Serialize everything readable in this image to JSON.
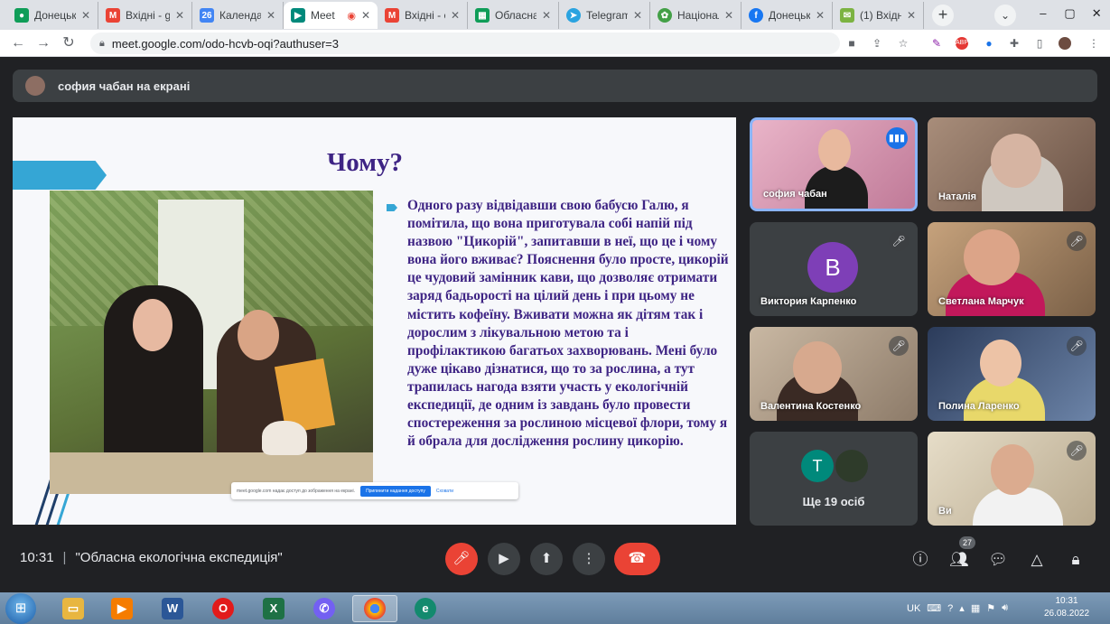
{
  "browser": {
    "tabs": [
      {
        "label": "Донецьк",
        "icon": "maps-pin-icon",
        "color": "#0f9d58"
      },
      {
        "label": "Вхідні - g",
        "icon": "gmail-icon",
        "color": "#ea4335"
      },
      {
        "label": "Календар",
        "icon": "calendar-icon",
        "color": "#4285f4"
      },
      {
        "label": "Meet",
        "icon": "meet-icon",
        "color": "#00897b",
        "active": true
      },
      {
        "label": "Вхідні - c",
        "icon": "gmail-icon",
        "color": "#ea4335"
      },
      {
        "label": "Обласна",
        "icon": "sheets-icon",
        "color": "#0f9d58"
      },
      {
        "label": "Telegram",
        "icon": "telegram-icon",
        "color": "#2aa3e0"
      },
      {
        "label": "Національ",
        "icon": "site-icon",
        "color": "#43a047"
      },
      {
        "label": "Донецьк",
        "icon": "facebook-icon",
        "color": "#1877f2"
      },
      {
        "label": "(1) Вхідн",
        "icon": "mail-icon",
        "color": "#7cb342"
      }
    ],
    "url": "meet.google.com/odo-hcvb-oqi?authuser=3"
  },
  "meet": {
    "presenter_label": "софия чабан на екрані",
    "slide": {
      "title": "Чому?",
      "body": "Одного разу відвідавши свою бабусю Галю, я помітила, що вона приготувала собі напій під назвою \"Цикорій\", запитавши в неї, що це і чому вона його вживає? Пояснення було просте, цикорій це чудовий замінник кави, що дозволяє отримати заряд бадьорості на цілий день і при цьому не містить кофеїну. Вживати можна як дітям так і дорослим з лікувальною метою та і профілактикою багатьох захворювань. Мені було дуже цікаво дізнатися, що то за рослина, а тут трапилась нагода взяти участь у екологічній експедиції, де одним із завдань було провести спостереження за рослиною місцевої флори, тому я й обрала для дослідження рослину цикорію.",
      "share_notice": "meet.google.com надає доступ до зображення на екрані.",
      "share_stop": "Припинити надання доступу",
      "share_hide": "Сховати"
    },
    "participants": [
      {
        "name": "софия чабан",
        "speaking": true
      },
      {
        "name": "Наталія",
        "speaking": false
      },
      {
        "name": "Виктория Карпенко",
        "avatar_letter": "B",
        "avatar_color": "#7e3fb7",
        "muted": true
      },
      {
        "name": "Светлана Марчук",
        "muted": true
      },
      {
        "name": "Валентина Костенко",
        "muted": true
      },
      {
        "name": "Полина Ларенко",
        "muted": true
      },
      {
        "name": "Ви",
        "muted": true
      }
    ],
    "others": {
      "label": "Ще 19 осіб",
      "avatar_letter": "T",
      "avatar_color": "#00897b"
    },
    "time": "10:31",
    "meeting_title": "\"Обласна екологічна експедиція\"",
    "people_count": "27"
  },
  "taskbar": {
    "lang": "UK",
    "time": "10:31",
    "date": "26.08.2022"
  }
}
